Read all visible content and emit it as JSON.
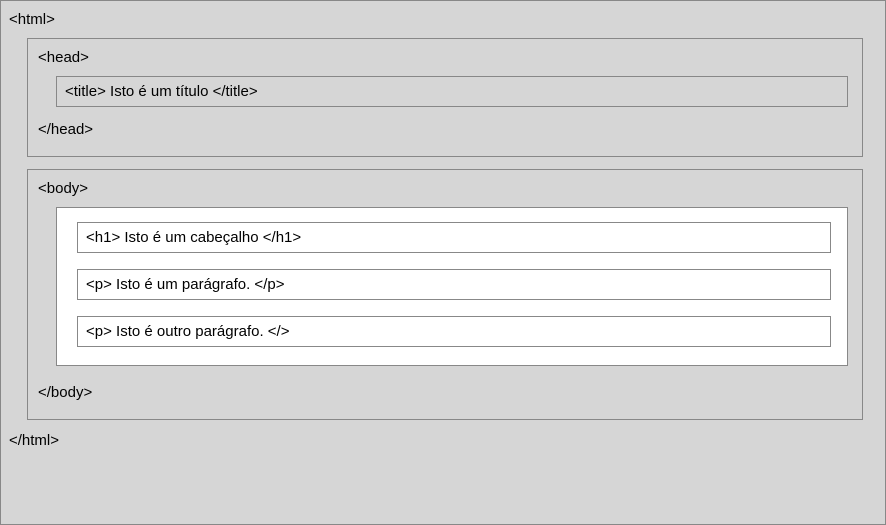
{
  "html": {
    "open": "<html>",
    "close": "</html>"
  },
  "head": {
    "open": "<head>",
    "close": "</head>",
    "title": "<title> Isto é um título </title>"
  },
  "body": {
    "open": "<body>",
    "close": "</body>",
    "elements": [
      "<h1> Isto é um cabeçalho </h1>",
      "<p> Isto é um parágrafo. </p>",
      "<p> Isto é outro parágrafo. </>"
    ]
  }
}
